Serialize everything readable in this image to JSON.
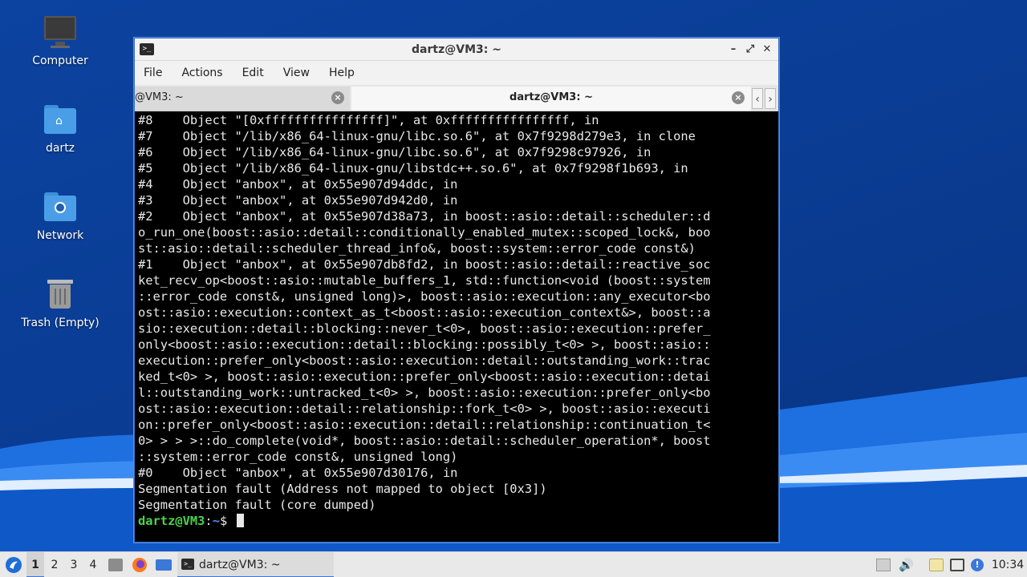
{
  "desktop": {
    "icons": [
      {
        "label": "Computer",
        "icon": "computer-icon"
      },
      {
        "label": "dartz",
        "icon": "home-folder-icon"
      },
      {
        "label": "Network",
        "icon": "network-folder-icon"
      },
      {
        "label": "Trash (Empty)",
        "icon": "trash-icon"
      }
    ]
  },
  "window": {
    "title": "dartz@VM3: ~",
    "buttons": {
      "minimize": "–",
      "maximize": "⤢",
      "close": "✕"
    },
    "menu": [
      "File",
      "Actions",
      "Edit",
      "View",
      "Help"
    ],
    "tabs": [
      {
        "label": "@VM3: ~",
        "active": false
      },
      {
        "label": "dartz@VM3: ~",
        "active": true
      }
    ],
    "tab_scroll": {
      "left": "‹",
      "right": "›"
    }
  },
  "terminal": {
    "lines": [
      "#8    Object \"[0xffffffffffffffff]\", at 0xffffffffffffffff, in",
      "#7    Object \"/lib/x86_64-linux-gnu/libc.so.6\", at 0x7f9298d279e3, in clone",
      "#6    Object \"/lib/x86_64-linux-gnu/libc.so.6\", at 0x7f9298c97926, in",
      "#5    Object \"/lib/x86_64-linux-gnu/libstdc++.so.6\", at 0x7f9298f1b693, in",
      "#4    Object \"anbox\", at 0x55e907d94ddc, in",
      "#3    Object \"anbox\", at 0x55e907d942d0, in",
      "#2    Object \"anbox\", at 0x55e907d38a73, in boost::asio::detail::scheduler::d",
      "o_run_one(boost::asio::detail::conditionally_enabled_mutex::scoped_lock&, boo",
      "st::asio::detail::scheduler_thread_info&, boost::system::error_code const&)",
      "#1    Object \"anbox\", at 0x55e907db8fd2, in boost::asio::detail::reactive_soc",
      "ket_recv_op<boost::asio::mutable_buffers_1, std::function<void (boost::system",
      "::error_code const&, unsigned long)>, boost::asio::execution::any_executor<bo",
      "ost::asio::execution::context_as_t<boost::asio::execution_context&>, boost::a",
      "sio::execution::detail::blocking::never_t<0>, boost::asio::execution::prefer_",
      "only<boost::asio::execution::detail::blocking::possibly_t<0> >, boost::asio::",
      "execution::prefer_only<boost::asio::execution::detail::outstanding_work::trac",
      "ked_t<0> >, boost::asio::execution::prefer_only<boost::asio::execution::detai",
      "l::outstanding_work::untracked_t<0> >, boost::asio::execution::prefer_only<bo",
      "ost::asio::execution::detail::relationship::fork_t<0> >, boost::asio::executi",
      "on::prefer_only<boost::asio::execution::detail::relationship::continuation_t<",
      "0> > > >::do_complete(void*, boost::asio::detail::scheduler_operation*, boost",
      "::system::error_code const&, unsigned long)",
      "#0    Object \"anbox\", at 0x55e907d30176, in",
      "Segmentation fault (Address not mapped to object [0x3])",
      "Segmentation fault (core dumped)"
    ],
    "prompt": {
      "user_host": "dartz@VM3",
      "sep": ":",
      "path": "~",
      "symbol": "$"
    }
  },
  "taskbar": {
    "workspaces": [
      "1",
      "2",
      "3",
      "4"
    ],
    "active_workspace": "1",
    "task_label": "dartz@VM3: ~",
    "clock": "10:34"
  },
  "colors": {
    "desktop_bg": "#0a3d95",
    "prompt_user": "#4ad34a",
    "prompt_path": "#5b8cff",
    "active_ws_accent": "#3b78d8"
  }
}
